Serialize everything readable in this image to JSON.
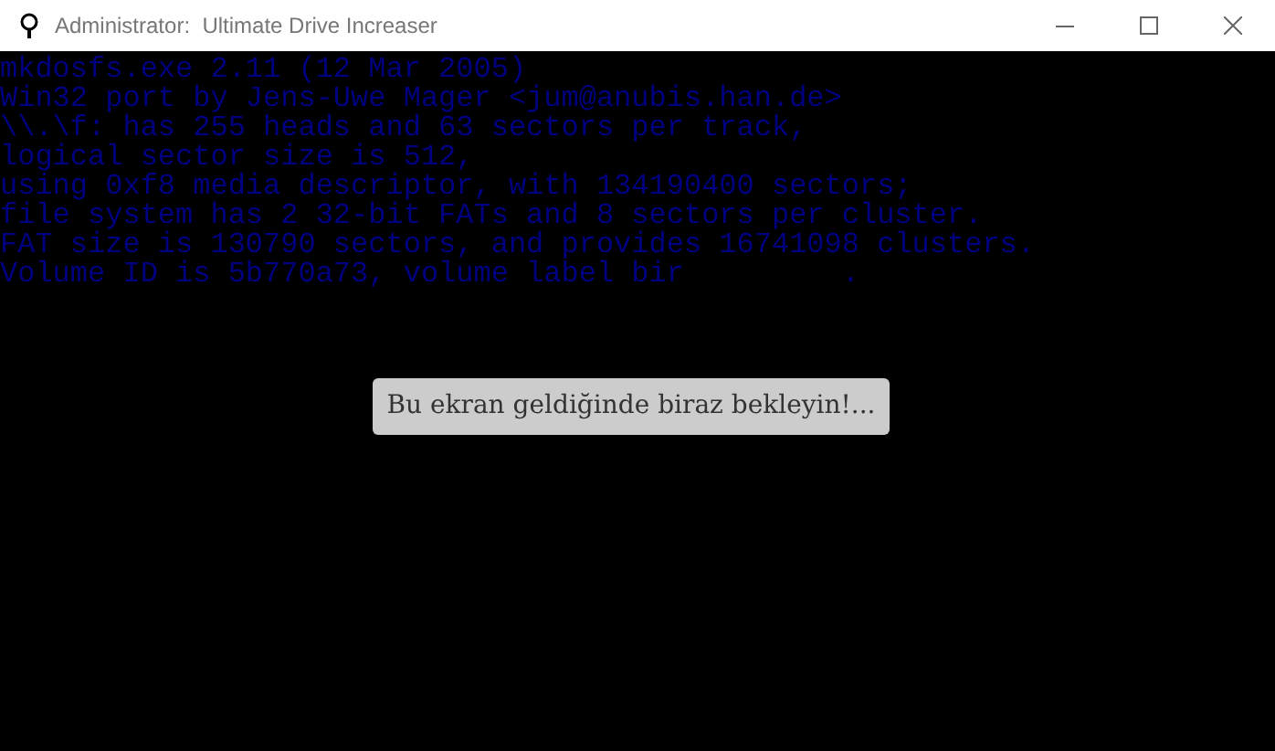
{
  "window": {
    "title": "Administrator:  Ultimate Drive Increaser"
  },
  "console_lines": [
    "mkdosfs.exe 2.11 (12 Mar 2005)",
    "Win32 port by Jens-Uwe Mager <jum@anubis.han.de>",
    "\\\\.\\f: has 255 heads and 63 sectors per track,",
    "logical sector size is 512,",
    "using 0xf8 media descriptor, with 134190400 sectors;",
    "file system has 2 32-bit FATs and 8 sectors per cluster.",
    "FAT size is 130790 sectors, and provides 16741098 clusters.",
    "Volume ID is 5b770a73, volume label bir         ."
  ],
  "notice": "Bu ekran geldiğinde biraz bekleyin!..."
}
